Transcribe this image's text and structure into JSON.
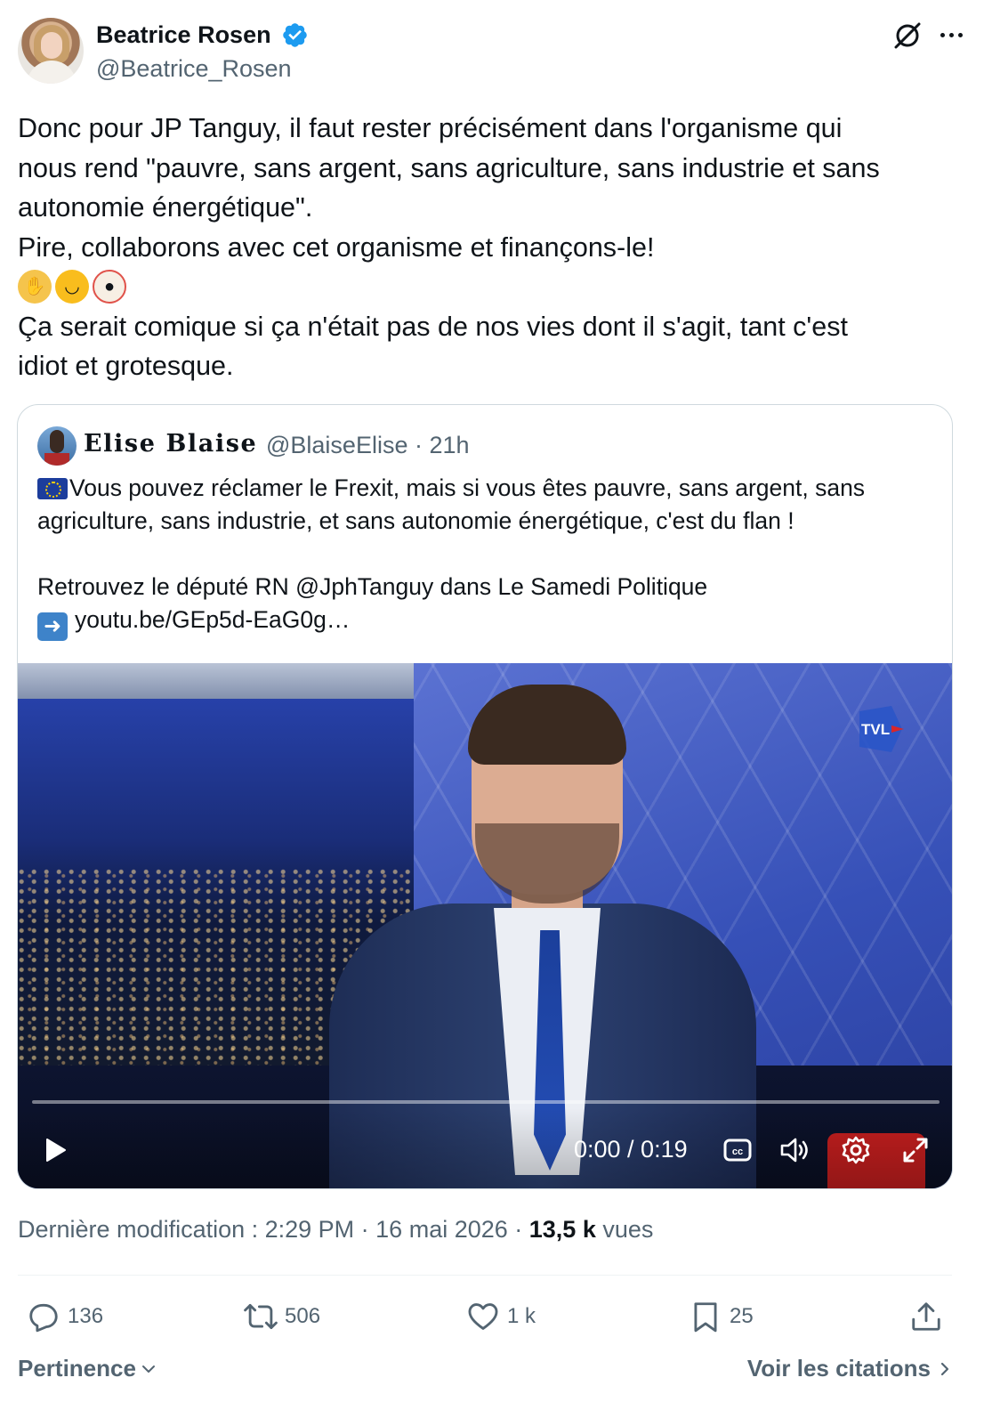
{
  "author": {
    "name": "Beatrice Rosen",
    "handle": "@Beatrice_Rosen"
  },
  "tweet": {
    "lines": [
      "Donc pour JP Tanguy, il faut rester précisément dans l'organisme qui",
      "nous rend \"pauvre, sans argent, sans agriculture, sans industrie et sans",
      "autonomie énergétique\".",
      "Pire, collaborons avec cet organisme et finançons-le!"
    ],
    "emojis": [
      "woman-facepalming",
      "upside-down-face",
      "clown-face"
    ],
    "lines_after": [
      "Ça serait comique si ça n'était pas de nos vies dont il s'agit, tant c'est",
      "idiot et grotesque."
    ]
  },
  "quote": {
    "name": "Elise Blaise",
    "handle_time": "@BlaiseElise · 21h",
    "line1": "Vous pouvez réclamer le Frexit, mais si vous êtes pauvre, sans argent, sans",
    "line2": "agriculture, sans industrie, et sans autonomie énergétique, c'est du flan !",
    "line3": "Retrouvez le député RN @JphTanguy dans Le Samedi Politique",
    "link": "youtu.be/GEp5d-EaG0g…",
    "video": {
      "time": "0:00 / 0:19",
      "progress": 0.0,
      "channel_logo": "TVL"
    }
  },
  "meta": {
    "prefix": "Dernière modification : 2:29 PM · 16 mai 2026 · ",
    "views_count": "13,5 k",
    "views_label": " vues"
  },
  "actions": {
    "replies": "136",
    "reposts": "506",
    "likes": "1 k",
    "bookmarks": "25"
  },
  "footer": {
    "sort_label": "Pertinence",
    "quotes_label": "Voir les citations"
  },
  "colors": {
    "text_primary": "#0f1419",
    "text_secondary": "#536471",
    "verified_blue": "#1d9bf0",
    "border": "#cfd9de"
  }
}
